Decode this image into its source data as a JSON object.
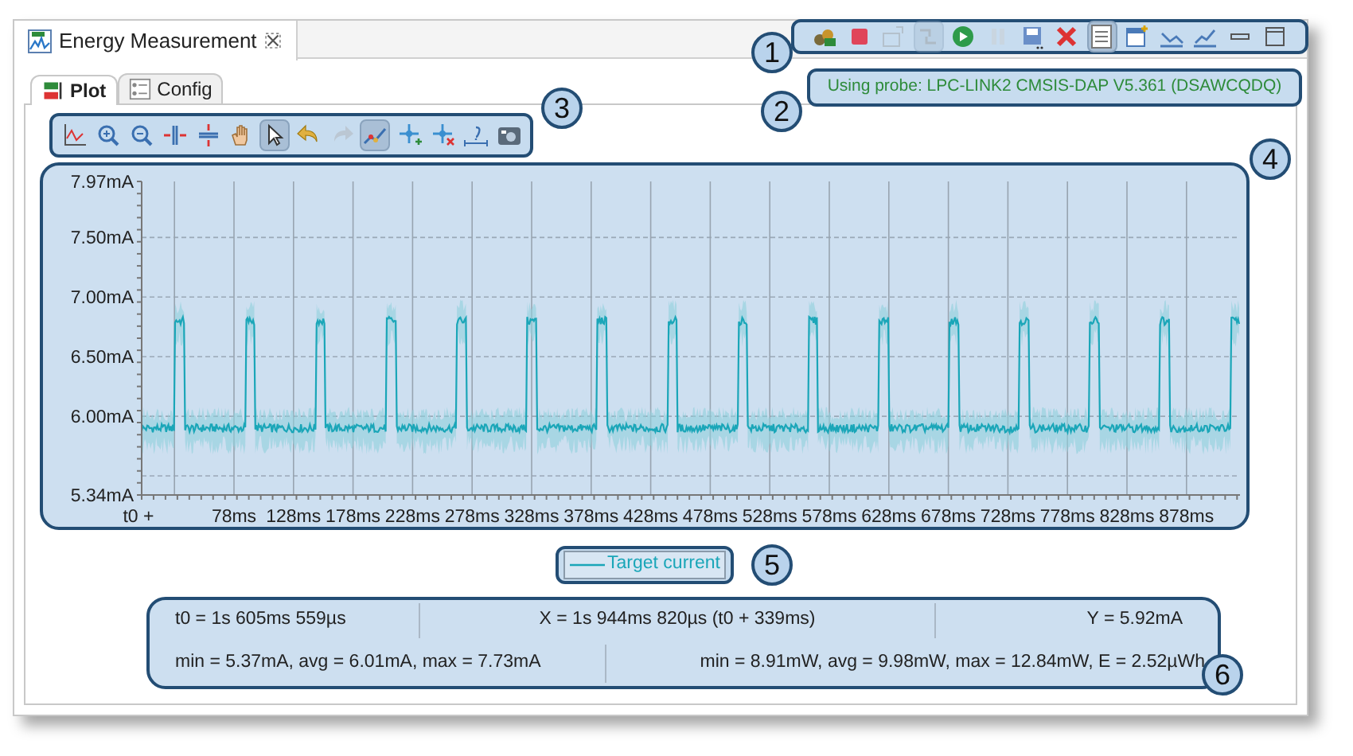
{
  "view_tab": {
    "title": "Energy Measurement"
  },
  "view_toolbar": [
    {
      "selected": false,
      "disabled": false
    },
    {
      "selected": false,
      "disabled": false
    },
    {
      "selected": false,
      "disabled": true
    },
    {
      "selected": true,
      "disabled": true
    },
    {
      "selected": false,
      "disabled": false
    },
    {
      "selected": false,
      "disabled": true
    },
    {
      "selected": false,
      "disabled": false
    },
    {
      "selected": false,
      "disabled": false
    },
    {
      "selected": true,
      "disabled": false
    },
    {
      "selected": false,
      "disabled": false
    },
    {
      "selected": false,
      "disabled": false
    },
    {
      "selected": false,
      "disabled": false
    },
    {
      "selected": false,
      "disabled": false
    },
    {
      "selected": false,
      "disabled": false
    }
  ],
  "sub_tabs": [
    {
      "label": "Plot",
      "selected": true
    },
    {
      "label": "Config",
      "selected": false
    }
  ],
  "probe_status": "Using probe: LPC-LINK2 CMSIS-DAP V5.361 (DSAWCQDQ)",
  "plot_toolbar": [
    {
      "selected": false,
      "disabled": false
    },
    {
      "selected": false,
      "disabled": false
    },
    {
      "selected": false,
      "disabled": false
    },
    {
      "selected": false,
      "disabled": false
    },
    {
      "selected": false,
      "disabled": false
    },
    {
      "selected": false,
      "disabled": false
    },
    {
      "selected": true,
      "disabled": false
    },
    {
      "selected": false,
      "disabled": false
    },
    {
      "selected": false,
      "disabled": true
    },
    {
      "selected": true,
      "disabled": false
    },
    {
      "selected": false,
      "disabled": false
    },
    {
      "selected": false,
      "disabled": false
    },
    {
      "selected": false,
      "disabled": false
    },
    {
      "selected": false,
      "disabled": false
    }
  ],
  "chart": {
    "y_labels": [
      "7.97mA",
      "7.50mA",
      "7.00mA",
      "6.50mA",
      "6.00mA",
      "5.34mA"
    ],
    "x_labels": [
      "t0 +",
      "78ms",
      "128ms",
      "178ms",
      "228ms",
      "278ms",
      "328ms",
      "378ms",
      "428ms",
      "478ms",
      "528ms",
      "578ms",
      "628ms",
      "678ms",
      "728ms",
      "778ms",
      "828ms",
      "878ms"
    ]
  },
  "legend": {
    "label": "Target current"
  },
  "stats": {
    "row_1": [
      "t0 = 1s 605ms 559µs",
      "X = 1s 944ms 820µs (t0 + 339ms)",
      "Y = 5.92mA"
    ],
    "row_2": [
      "min = 5.37mA, avg = 6.01mA, max = 7.73mA",
      "min = 8.91mW, avg = 9.98mW, max = 12.84mW, E = 2.52µWh"
    ]
  },
  "callouts": [
    "1",
    "2",
    "3",
    "4",
    "5",
    "6"
  ]
}
